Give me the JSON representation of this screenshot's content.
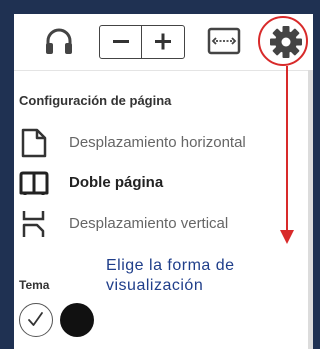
{
  "section_title": "Configuración de página",
  "layout_options": [
    {
      "label": "Desplazamiento horizontal",
      "icon": "page-icon",
      "selected": false
    },
    {
      "label": "Doble página",
      "icon": "open-book-icon",
      "selected": true
    },
    {
      "label": "Desplazamiento vertical",
      "icon": "vertical-scroll-icon",
      "selected": false
    }
  ],
  "theme": {
    "label": "Tema",
    "options": [
      {
        "name": "light",
        "color": "#ffffff",
        "selected": true
      },
      {
        "name": "dark",
        "color": "#111111",
        "selected": false
      }
    ]
  },
  "annotation": {
    "text": "Elige la forma de visualización",
    "color": "#d82a2a"
  },
  "toolbar": {
    "icons": [
      "headphones-icon",
      "zoom-out-icon",
      "zoom-in-icon",
      "fit-width-icon",
      "settings-gear-icon"
    ]
  }
}
